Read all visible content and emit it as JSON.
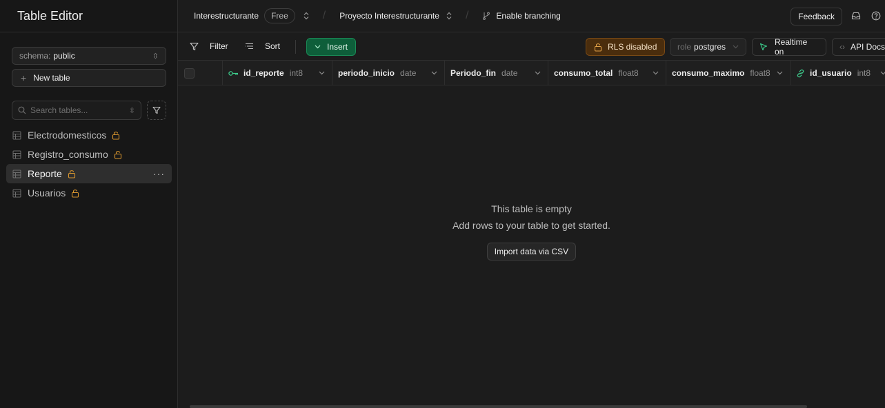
{
  "sidebar": {
    "title": "Table Editor",
    "schema_label": "schema:",
    "schema_value": "public",
    "new_table_label": "New table",
    "search_placeholder": "Search tables...",
    "tables": [
      {
        "name": "Electrodomesticos",
        "active": false
      },
      {
        "name": "Registro_consumo",
        "active": false
      },
      {
        "name": "Reporte",
        "active": true
      },
      {
        "name": "Usuarios",
        "active": false
      }
    ]
  },
  "topbar": {
    "org": "Interestructurante",
    "plan_badge": "Free",
    "project": "Proyecto Interestructurante",
    "branching": "Enable branching",
    "feedback": "Feedback"
  },
  "toolbar": {
    "filter": "Filter",
    "sort": "Sort",
    "insert": "Insert",
    "rls": "RLS disabled",
    "role_label": "role",
    "role_value": "postgres",
    "realtime": "Realtime on",
    "api_docs": "API Docs"
  },
  "columns": [
    {
      "name": "id_reporte",
      "type": "int8",
      "icon": "key-icon"
    },
    {
      "name": "periodo_inicio",
      "type": "date",
      "icon": ""
    },
    {
      "name": "Periodo_fin",
      "type": "date",
      "icon": ""
    },
    {
      "name": "consumo_total",
      "type": "float8",
      "icon": ""
    },
    {
      "name": "consumo_maximo",
      "type": "float8",
      "icon": ""
    },
    {
      "name": "id_usuario",
      "type": "int8",
      "icon": "link-icon"
    }
  ],
  "empty_state": {
    "title": "This table is empty",
    "subtitle": "Add rows to your table to get started.",
    "import_button": "Import data via CSV"
  },
  "colors": {
    "background": "#1c1c1c",
    "sidebar": "#171717",
    "insert_green": "#0e5e3a",
    "rls_orange": "#4a2d0d",
    "lock_amber": "#d9962e",
    "key_green": "#3ecf8e"
  }
}
